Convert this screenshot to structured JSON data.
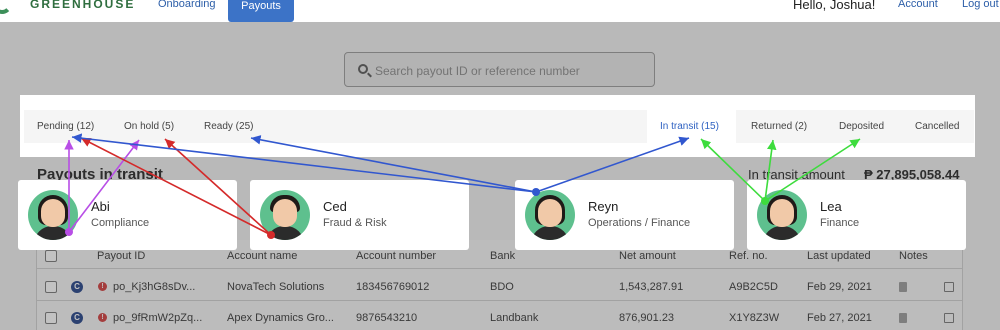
{
  "nav": {
    "brand": "GREENHOUSE",
    "links": [
      "Onboarding",
      "Payouts"
    ],
    "greeting": "Hello, Joshua!",
    "account": "Account",
    "logout": "Log out"
  },
  "search": {
    "placeholder": "Search payout ID or reference number"
  },
  "tabs": [
    "Pending (12)",
    "On hold (5)",
    "Ready (25)",
    "In transit (15)",
    "Returned (2)",
    "Deposited",
    "Cancelled"
  ],
  "heading": {
    "title": "Payouts in transit",
    "amount_label": "In transit amount",
    "amount_value": "₱ 27,895,058.44"
  },
  "table": {
    "columns": [
      "Payout ID",
      "Account name",
      "Account number",
      "Bank",
      "Net amount",
      "Ref. no.",
      "Last updated",
      "Notes"
    ],
    "rows": [
      {
        "id": "po_Kj3hG8sDv...",
        "account_name": "NovaTech Solutions",
        "account_number": "183456769012",
        "bank": "BDO",
        "net_amount": "1,543,287.91",
        "ref": "A9B2C5D",
        "updated": "Feb 29, 2021"
      },
      {
        "id": "po_9fRmW2pZq...",
        "account_name": "Apex Dynamics Gro...",
        "account_number": "9876543210",
        "bank": "Landbank",
        "net_amount": "876,901.23",
        "ref": "X1Y8Z3W",
        "updated": "Feb 27, 2021"
      }
    ],
    "badge_letter": "C"
  },
  "people": [
    {
      "name": "Abi",
      "role": "Compliance"
    },
    {
      "name": "Ced",
      "role": "Fraud & Risk"
    },
    {
      "name": "Reyn",
      "role": "Operations / Finance"
    },
    {
      "name": "Lea",
      "role": "Finance"
    }
  ],
  "colors": {
    "abi": "#b84ee6",
    "ced": "#d42a2a",
    "reyn": "#3157cf",
    "lea": "#3ddc3d",
    "accent": "#3c73c7"
  }
}
